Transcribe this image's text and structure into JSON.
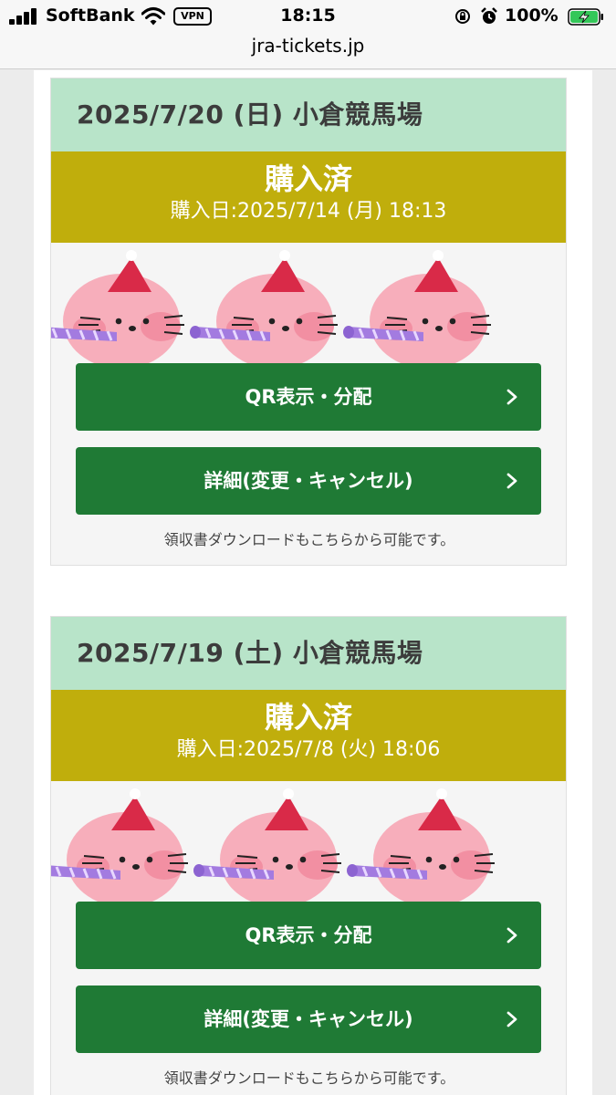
{
  "status_bar": {
    "carrier": "SoftBank",
    "vpn": "VPN",
    "time": "18:15",
    "battery": "100%"
  },
  "browser": {
    "url": "jra-tickets.jp"
  },
  "tickets": [
    {
      "header": "2025/7/20 (日) 小倉競馬場",
      "status": "購入済",
      "purchase_date": "購入日:2025/7/14 (月) 18:13",
      "qr_button": "QR表示・分配",
      "detail_button": "詳細(変更・キャンセル)",
      "note": "領収書ダウンロードもこちらから可能です。"
    },
    {
      "header": "2025/7/19 (土) 小倉競馬場",
      "status": "購入済",
      "purchase_date": "購入日:2025/7/8 (火) 18:06",
      "qr_button": "QR表示・分配",
      "detail_button": "詳細(変更・キャンセル)",
      "note": "領収書ダウンロードもこちらから可能です。"
    }
  ],
  "icons": {
    "chevron": "chevron-right-icon",
    "illustration": "seal-mascot-illustration"
  },
  "colors": {
    "header_bg": "#b8e4c9",
    "status_bg": "#c0ae0c",
    "button_bg": "#1f7a35"
  }
}
